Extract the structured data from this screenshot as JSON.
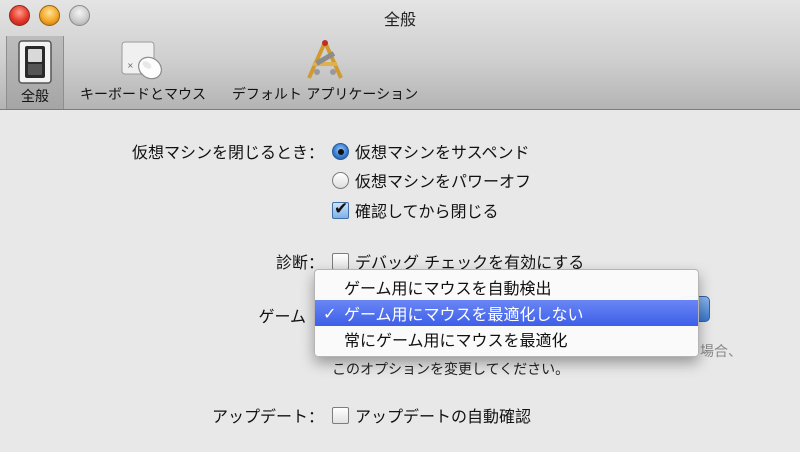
{
  "window": {
    "title": "全般"
  },
  "toolbar": {
    "items": [
      {
        "label": "全般",
        "icon": "general-switch-icon"
      },
      {
        "label": "キーボードとマウス",
        "icon": "mouse-icon"
      },
      {
        "label": "デフォルト アプリケーション",
        "icon": "applications-icon"
      }
    ]
  },
  "close_vm": {
    "label": "仮想マシンを閉じるとき：",
    "options": [
      {
        "label": "仮想マシンをサスペンド",
        "selected": true
      },
      {
        "label": "仮想マシンをパワーオフ",
        "selected": false
      }
    ],
    "confirm": {
      "label": "確認してから閉じる",
      "checked": true
    }
  },
  "diagnostics": {
    "label": "診断：",
    "debug": {
      "label": "デバッグ チェックを有効にする",
      "checked": false
    }
  },
  "gaming": {
    "label": "ゲーム",
    "hint_faint": "場合、",
    "hint": "このオプションを変更してください。",
    "menu": {
      "items": [
        {
          "label": "ゲーム用にマウスを自動検出",
          "selected": false
        },
        {
          "label": "ゲーム用にマウスを最適化しない",
          "selected": true
        },
        {
          "label": "常にゲーム用にマウスを最適化",
          "selected": false
        }
      ],
      "checkmark": "✓"
    }
  },
  "updates": {
    "label": "アップデート：",
    "auto": {
      "label": "アップデートの自動確認",
      "checked": false
    }
  },
  "colors": {
    "accent": "#3d5fe8",
    "radio_on": "#3a7fd0"
  }
}
